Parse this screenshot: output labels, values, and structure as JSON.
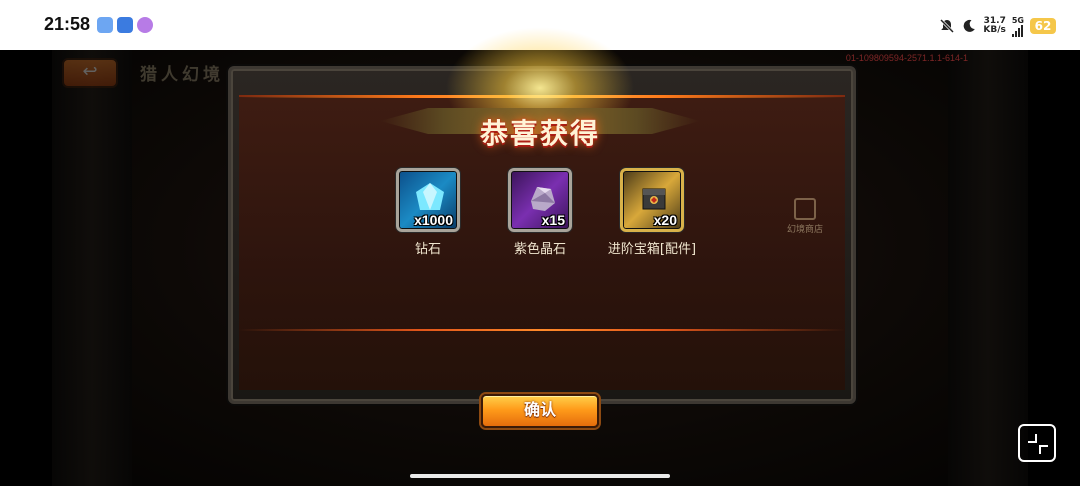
{
  "status_bar": {
    "time": "21:58",
    "net_speed": [
      "31.7",
      "KB/s"
    ],
    "network_type": "5G",
    "battery": "62"
  },
  "scene": {
    "title": "猎人幻境",
    "build_id": "01-109809594-2571.1.1-614-1",
    "shop_label": "幻境商店"
  },
  "dialog": {
    "title": "恭喜获得",
    "rewards": [
      {
        "name": "钻石",
        "count": "x1000",
        "icon": "diamond-icon"
      },
      {
        "name": "紫色晶石",
        "count": "x15",
        "icon": "purple-crystal-icon"
      },
      {
        "name": "进阶宝箱[配件]",
        "count": "x20",
        "icon": "chest-icon"
      }
    ],
    "confirm_label": "确认"
  },
  "colors": {
    "accent_orange": "#ff9b1a",
    "title_glow": "#ffcd3c",
    "build_id_red": "#c23b3b"
  }
}
